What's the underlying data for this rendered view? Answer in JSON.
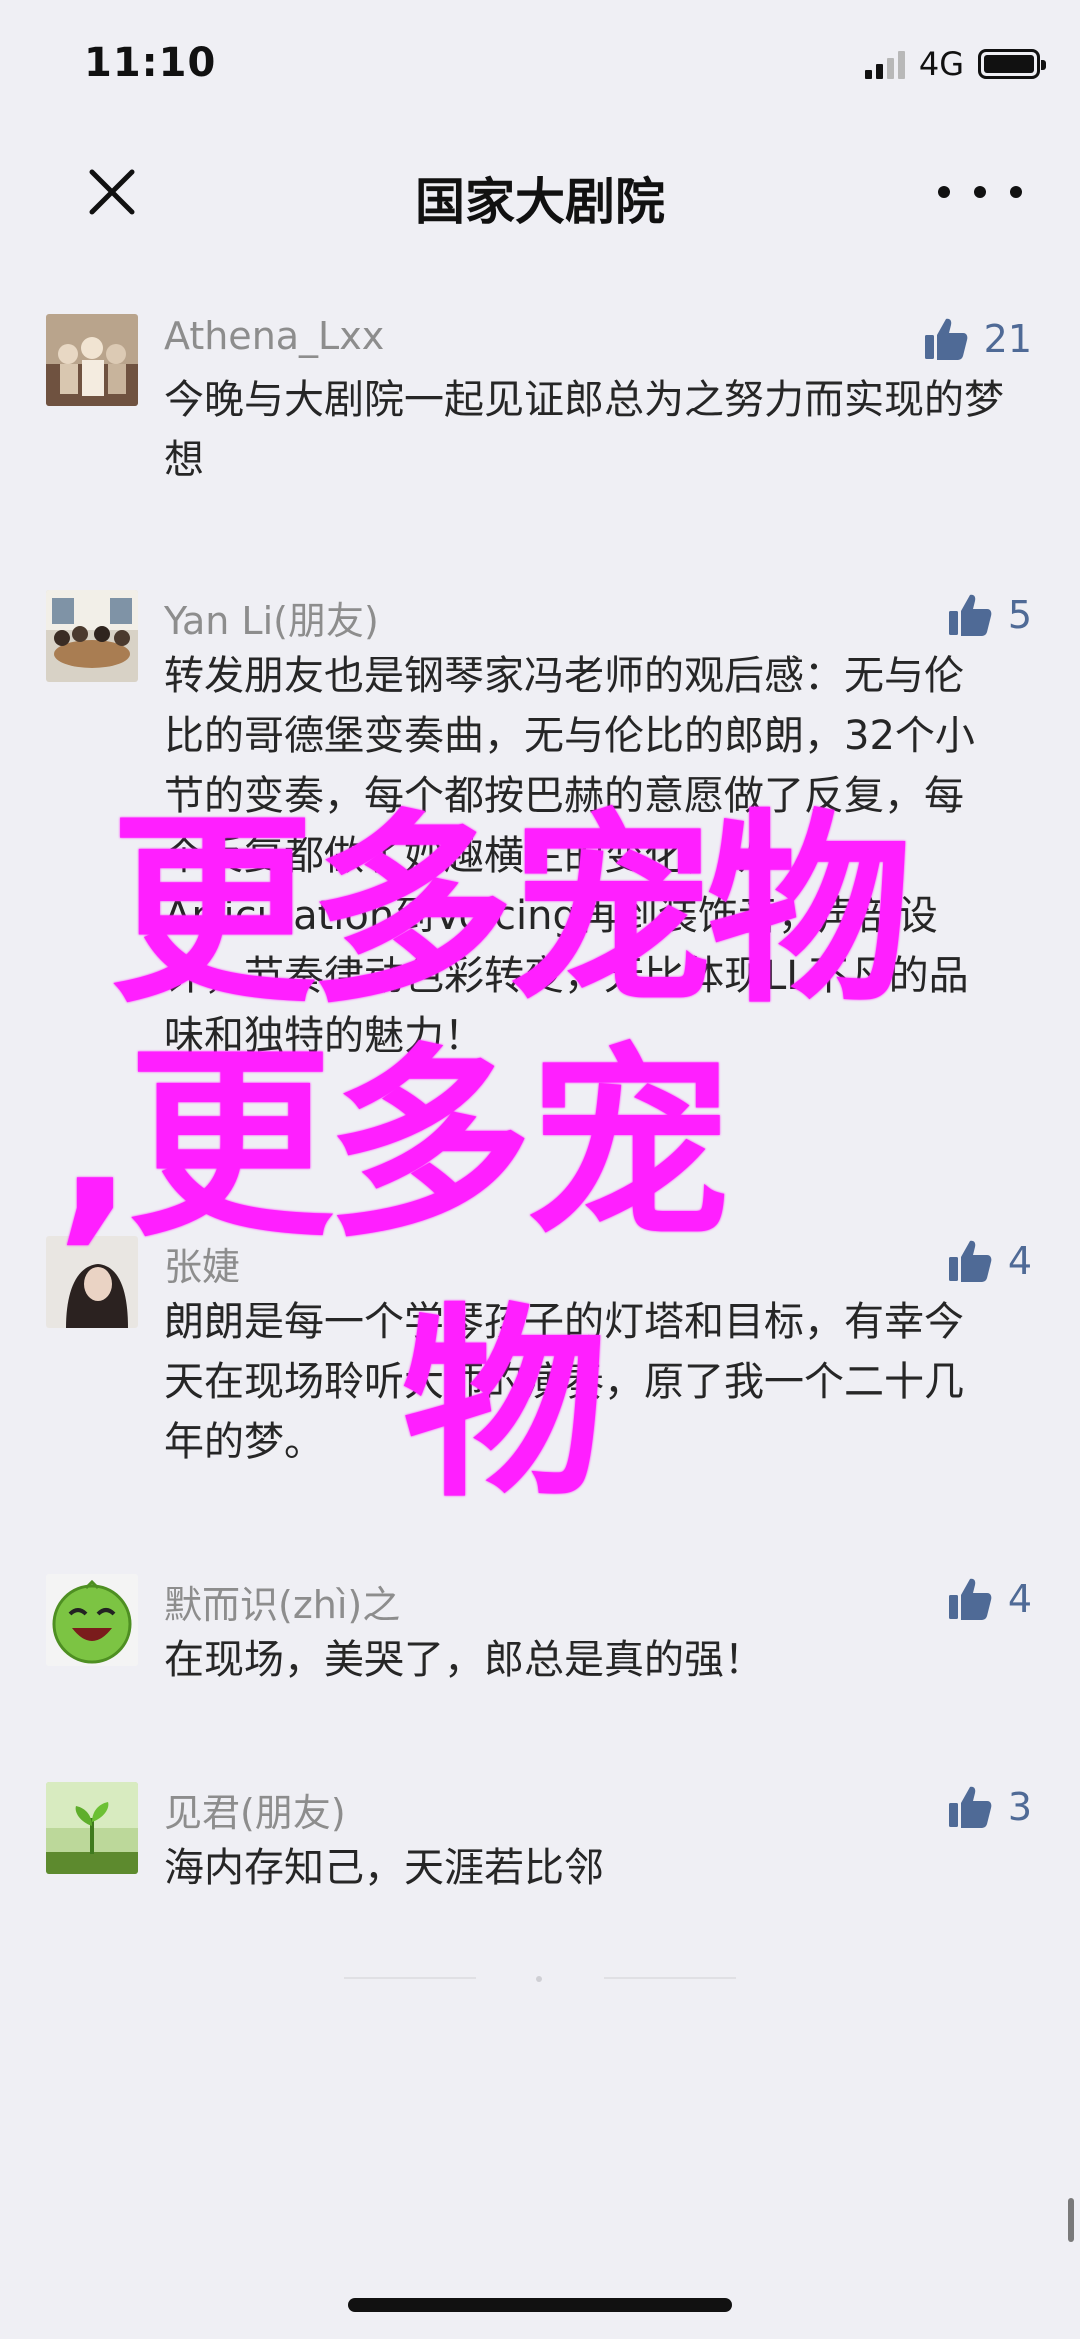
{
  "status_bar": {
    "time": "11:10",
    "network": "4G"
  },
  "nav": {
    "title": "国家大剧院"
  },
  "comments": [
    {
      "name": "Athena_Lxx",
      "text": "今晚与大剧院一起见证郎总为之努力而实现的梦想",
      "likes": "21"
    },
    {
      "name": "Yan Li(朋友)",
      "text": "转发朋友也是钢琴家冯老师的观后感：无与伦比的哥德堡变奏曲，无与伦比的郎朗，32个小节的变奏，每个都按巴赫的意愿做了反复，每个反复都做了妙趣横生的变化，从Articulation到Voicing再到装饰音，声部设计，节奏律动色彩转变，无比体现LL不凡的品味和独特的魅力！",
      "likes": "5"
    },
    {
      "name": "张婕",
      "text": "朗朗是每一个学琴孩子的灯塔和目标，有幸今天在现场聆听大师的演奏，原了我一个二十几年的梦。",
      "likes": "4"
    },
    {
      "name": "默而识(zhì)之",
      "text": "在现场，美哭了，郎总是真的强！",
      "likes": "4"
    },
    {
      "name": "见君(朋友)",
      "text": "海内存知己，天涯若比邻",
      "likes": "3"
    }
  ],
  "watermark": {
    "line1": "更多宠物",
    "line2": ",更多宠",
    "line3": "物"
  },
  "colors": {
    "watermark": "#ff1fff",
    "like_blue": "#4f6a96",
    "background": "#efeff4"
  },
  "icons": {
    "close": "close-icon",
    "more": "more-icon",
    "like": "thumb-up-icon"
  }
}
